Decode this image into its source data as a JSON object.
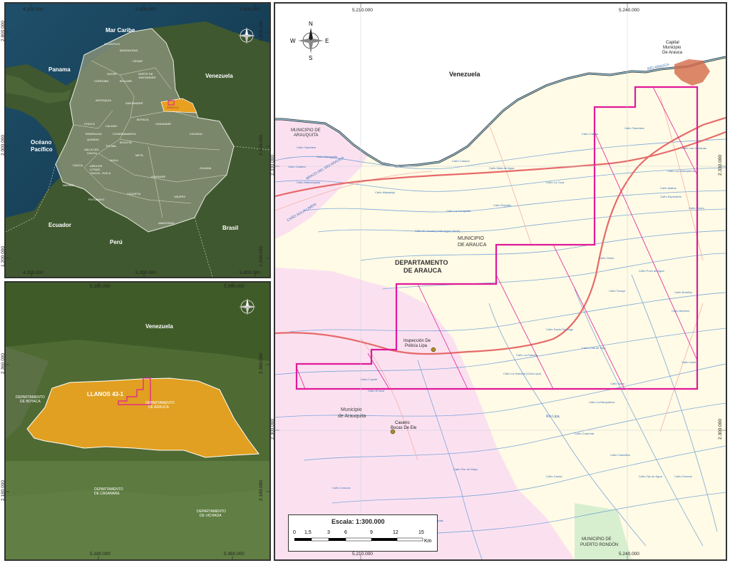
{
  "overview": {
    "coords_top": [
      "4.200.000",
      "5.000.000",
      "5.800.000"
    ],
    "coords_bottom": [
      "4.200.000",
      "5.000.000",
      "5.800.000"
    ],
    "coords_left": [
      "2.800.000",
      "2.000.000",
      "1.200.000"
    ],
    "coords_right": [
      "2.800.000",
      "2.000.000",
      "1.200.000"
    ],
    "labels": {
      "mar_caribe": "Mar Caribe",
      "panama": "Panama",
      "venezuela": "Venezuela",
      "oceano": "Océano",
      "pacifico": "Pacífico",
      "ecuador": "Ecuador",
      "peru": "Perú",
      "brasil": "Brasil"
    },
    "departments": [
      "ATLANTICO",
      "MAGDALENA",
      "CESAR",
      "SUCRE",
      "CORDOBA",
      "BOLIVAR",
      "NORTE DE",
      "SANTANDER",
      "ANTIOQUIA",
      "SANTANDER",
      "ARAUCA",
      "BOYACA",
      "CASANARE",
      "CHOCO",
      "CALDAS",
      "RISARALDA",
      "CUNDINAMARCA",
      "QUINDIO",
      "VALLE DEL",
      "CAUCA",
      "TOLIMA",
      "BOGOTA",
      "HUILA",
      "META",
      "VICHADA",
      "CAUCA",
      "NARIÑO",
      "CAQUETA",
      "PUTUMAYO",
      "GUAVIARE",
      "GUAINIA",
      "VAUPES",
      "AMAZONAS",
      "AREA EN",
      "LITIGIO",
      "CAUCA - HUILA"
    ]
  },
  "regional": {
    "coords_top": [
      "5.180.000",
      "5.360.000"
    ],
    "coords_bottom": [
      "5.180.000",
      "5.360.000"
    ],
    "coords_left": [
      "2.360.000",
      "2.180.000"
    ],
    "coords_right": [
      "2.360.000",
      "2.180.000"
    ],
    "labels": {
      "venezuela": "Venezuela",
      "block": "LLANOS 43-1",
      "dep_arauca_1": "DEPARTAMENTO",
      "dep_arauca_2": "DE ARAUCA",
      "dep_boyaca_1": "DEPARTAMENTO",
      "dep_boyaca_2": "DE BOYACA",
      "dep_casanare_1": "DEPARTAMENTO",
      "dep_casanare_2": "DE CASANARE",
      "dep_vichada_1": "DEPARTAMENTO",
      "dep_vichada_2": "DE VICHADA"
    }
  },
  "detail": {
    "coords_top": [
      "5.210.000",
      "5.240.000"
    ],
    "coords_bottom": [
      "5.210.000",
      "5.240.000"
    ],
    "coords_left": [
      "2.330.000",
      "2.300.000"
    ],
    "coords_right": [
      "2.330.000",
      "2.300.000"
    ],
    "labels": {
      "venezuela": "Venezuela",
      "capital_1": "Capital",
      "capital_2": "Municipio",
      "capital_3": "De Arauca",
      "mun_arauquita_1": "MUNICIPIO DE",
      "mun_arauquita_2": "ARAUQUITA",
      "mun_arauca_1": "MUNICIPIO",
      "mun_arauca_2": "DE ARAUCA",
      "dep_1": "DEPARTAMENTO",
      "dep_2": "DE ARAUCA",
      "insp_1": "Inspección De",
      "insp_2": "Policía Lipa",
      "mun_arauquita2_1": "Municipio",
      "mun_arauquita2_2": "de Arauquita",
      "caserio_1": "Caserio",
      "caserio_2": "Bocas De Ele",
      "mun_pr_1": "MUNICIPIO DE",
      "mun_pr_2": "PUERTO RONDÓN",
      "rio_arauca": "RÍO ARAUCA",
      "brazo": "BRAZO DEL RÍO ARAUCA",
      "cano_agua": "CAÑO AGUA LIMÓN",
      "rio_lipa": "Río Lipa"
    },
    "streams": [
      "Caño Tauretere",
      "Caño Caldera",
      "Caño Metaguilla",
      "Caño Matarreguas",
      "Caño Caracol",
      "Caño Mata de Agua",
      "Caño Matapiojo",
      "Caño La Conquista",
      "Caño El Caudal (Caño Agua Verde)",
      "Caño Papujito",
      "Caño La Yuca",
      "Caño Caldas",
      "Caño Tauretera",
      "Caño Mattos",
      "Caño Esprestnte",
      "Caño Los Aranqueros",
      "Caño Las Ventanas",
      "Caño Vivero",
      "Caño Osmo",
      "Caño Pozo de Agua",
      "Caño Bolaños",
      "Caño Areveno",
      "Caño Limón",
      "Caño Tocuyo",
      "Caño Sano",
      "Caño Clavellino",
      "Caño Ojo de Agua",
      "Caño Ocumal",
      "Caño La Pastora",
      "Caño Santo Domingo",
      "Caño La Soledad (Caño Lipa)",
      "Caño La Barquetera",
      "Caño Cuarenta",
      "Caño Cola de Palo",
      "Caño Canoa",
      "Caño Coyote",
      "Caño El Azul",
      "Caño Corozos",
      "Caño Caradas",
      "Caño Flor de Mayo"
    ],
    "scale": {
      "title": "Escala: 1:300.000",
      "ticks": [
        "0",
        "1,5",
        "3",
        "6",
        "9",
        "12",
        "15"
      ],
      "unit": "Km"
    },
    "compass": {
      "n": "N",
      "s": "S",
      "e": "E",
      "w": "W"
    }
  }
}
